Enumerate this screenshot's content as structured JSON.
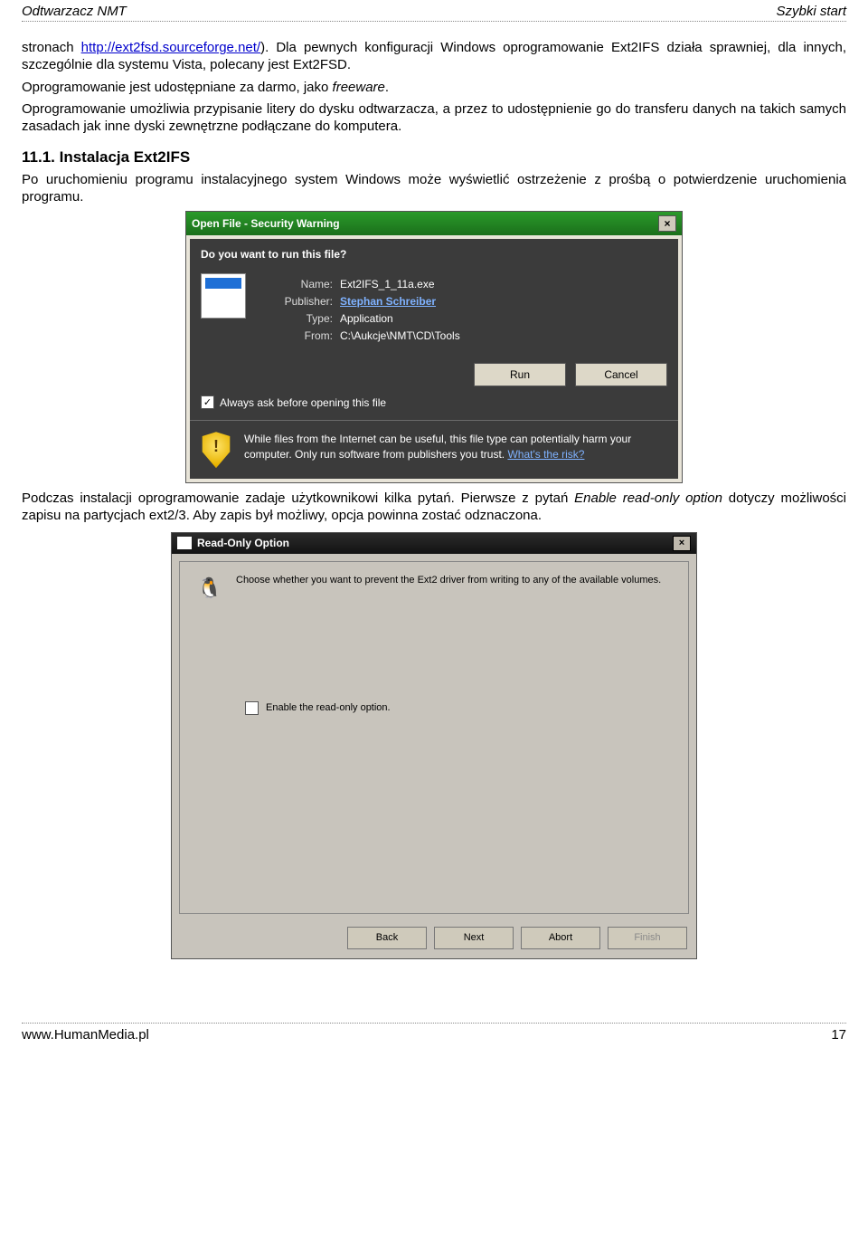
{
  "header": {
    "left": "Odtwarzacz NMT",
    "right": "Szybki start"
  },
  "footer": {
    "left": "www.HumanMedia.pl",
    "right": "17"
  },
  "body": {
    "p1_a": "stronach ",
    "p1_link": "http://ext2fsd.sourceforge.net/",
    "p1_b": "). Dla pewnych konfiguracji Windows oprogramowanie Ext2IFS działa sprawniej, dla innych, szczególnie dla systemu Vista, polecany jest Ext2FSD.",
    "p2_a": "Oprogramowanie jest udostępniane za darmo, jako ",
    "p2_i": "freeware",
    "p2_b": ".",
    "p3": "Oprogramowanie umożliwia przypisanie litery do dysku odtwarzacza, a przez to udostępnienie go do transferu danych na takich samych zasadach jak inne dyski zewnętrzne podłączane do komputera.",
    "h1": "11.1. Instalacja Ext2IFS",
    "p4": "Po uruchomieniu programu instalacyjnego system Windows może wyświetlić ostrzeżenie z prośbą o potwierdzenie uruchomienia programu.",
    "p5_a": "Podczas instalacji oprogramowanie zadaje użytkownikowi kilka pytań. Pierwsze z pytań ",
    "p5_i": "Enable read-only option",
    "p5_b": " dotyczy możliwości zapisu na partycjach ext2/3. Aby zapis był możliwy, opcja powinna zostać odznaczona."
  },
  "dlg1": {
    "title": "Open File - Security Warning",
    "close": "×",
    "question": "Do you want to run this file?",
    "name_k": "Name:",
    "name_v": "Ext2IFS_1_11a.exe",
    "pub_k": "Publisher:",
    "pub_v": "Stephan Schreiber",
    "type_k": "Type:",
    "type_v": "Application",
    "from_k": "From:",
    "from_v": "C:\\Aukcje\\NMT\\CD\\Tools",
    "run": "Run",
    "cancel": "Cancel",
    "check_mark": "✓",
    "check_label": "Always ask before opening this file",
    "warn": "While files from the Internet can be useful, this file type can potentially harm your computer. Only run software from publishers you trust. ",
    "warn_link": "What's the risk?"
  },
  "dlg2": {
    "title": "Read-Only Option",
    "close": "×",
    "intro": "Choose whether you want to prevent the Ext2 driver from writing to any of the available volumes.",
    "check_label": "Enable the read-only option.",
    "penguin": "🐧",
    "back": "Back",
    "next": "Next",
    "abort": "Abort",
    "finish": "Finish"
  }
}
